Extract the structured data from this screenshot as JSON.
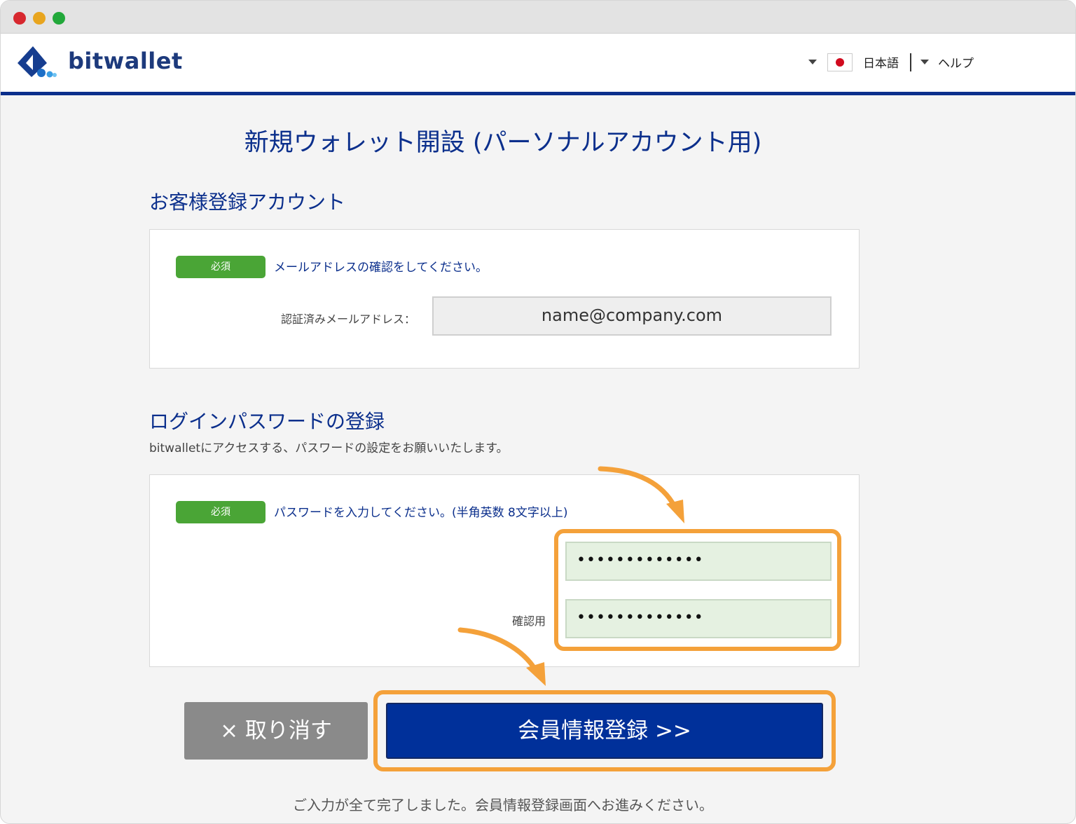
{
  "window": {
    "controls": [
      "close",
      "minimize",
      "maximize"
    ]
  },
  "header": {
    "brand": "bitwallet",
    "language_label": "日本語",
    "help_label": "ヘルプ",
    "flag_icon": "japan-flag-icon"
  },
  "page": {
    "title": "新規ウォレット開設 (パーソナルアカウント用)"
  },
  "customer_section": {
    "title": "お客様登録アカウント",
    "required_badge": "必須",
    "hint": "メールアドレスの確認をしてください。",
    "verified_email_label": "認証済みメールアドレス：",
    "verified_email_value": "name@company.com"
  },
  "password_section": {
    "title": "ログインパスワードの登録",
    "description": "bitwalletにアクセスする、パスワードの設定をお願いいたします。",
    "required_badge": "必須",
    "hint": "パスワードを入力してください。(半角英数 8文字以上)",
    "password_value": "•••••••••••••",
    "confirm_label": "確認用",
    "confirm_value": "•••••••••••••"
  },
  "actions": {
    "cancel_label": "× 取り消す",
    "submit_label": "会員情報登録 >>"
  },
  "footer_note": "ご入力が全て完了しました。会員情報登録画面へお進みください。",
  "colors": {
    "brand_navy": "#0b2f8c",
    "required_green": "#4aa536",
    "highlight_orange": "#f4a13a",
    "cancel_gray": "#8a8a8a",
    "submit_blue": "#00309a"
  }
}
